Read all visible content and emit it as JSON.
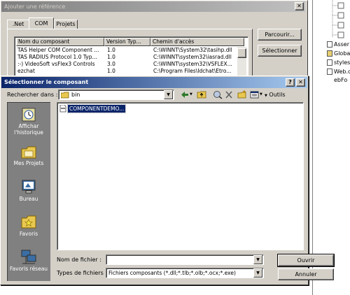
{
  "bg_dialog": {
    "title": "Ajouter une référence",
    "close_glyph": "✕",
    "tabs": [
      ".Net",
      "COM",
      "Projets"
    ],
    "columns": [
      "Nom du composant",
      "Version Typ...",
      "Chemin d'accès"
    ],
    "rows": [
      [
        "TAS Helper COM Component ...",
        "1.0",
        "C:\\WINNT\\System32\\tasihp.dll"
      ],
      [
        "TAS RADIUS Protocol 1.0 Typ...",
        "1.0",
        "C:\\WINNT\\system32\\iasrad.dll"
      ],
      [
        ":-) VideoSoft vsFlex3 Controls",
        "3.0",
        "C:\\WINNT\\system32\\VSFLEX..."
      ],
      [
        "ezchat",
        "1.0",
        "C:\\Program Files\\Idchat\\Etro..."
      ]
    ],
    "browse_label": "Parcourir...",
    "select_label": "Sélectionner"
  },
  "right_panel": {
    "items": [
      "Asser",
      "Globa",
      "stylesl",
      "Web.c",
      "ebFo"
    ]
  },
  "dialog": {
    "title": "Sélectionner le composant",
    "help_glyph": "?",
    "close_glyph": "✕",
    "look_in_label": "Rechercher dans :",
    "look_in_value": "bin",
    "tools_label": "Outils",
    "places": [
      {
        "icon": "history-icon",
        "label": "Affichar l'historique"
      },
      {
        "icon": "my-projects-icon",
        "label": "Mes Projets"
      },
      {
        "icon": "desktop-icon",
        "label": "Bureau"
      },
      {
        "icon": "favorites-icon",
        "label": "Favoris"
      },
      {
        "icon": "network-favorites-icon",
        "label": "Favoris réseau"
      }
    ],
    "files": [
      "COMPONENTDEMO..."
    ],
    "filename_label": "Nom de fichier :",
    "filename_value": "",
    "filetype_label": "Types de fichiers :",
    "filetype_value": "Fichiers composants (*.dll;*.tlb;*.olb;*.ocx;*.exe)",
    "open_label": "Ouvrir",
    "cancel_label": "Annuler"
  },
  "colors": {
    "title_active": "#0a246a",
    "title_active_end": "#a6caf0",
    "face": "#d4d0c8",
    "selection": "#0a246a"
  }
}
